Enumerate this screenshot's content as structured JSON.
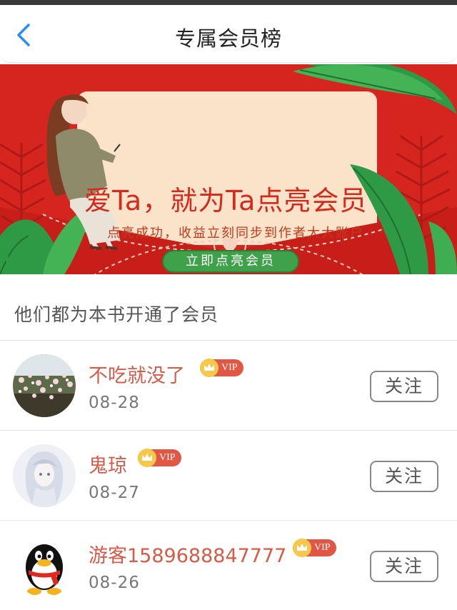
{
  "nav": {
    "title": "专属会员榜"
  },
  "banner": {
    "headline": "爱Ta，就为Ta点亮会员",
    "subtitle": "点亮成功，收益立刻同步到作者大大账户",
    "cta_label": "立即点亮会员"
  },
  "section": {
    "heading": "他们都为本书开通了会员"
  },
  "members": [
    {
      "name": "不吃就没了",
      "vip_label": "VIP",
      "date": "08-28",
      "follow_label": "关注",
      "avatar_icon": "flower-avatar-icon"
    },
    {
      "name": "鬼琼",
      "vip_label": "VIP",
      "date": "08-27",
      "follow_label": "关注",
      "avatar_icon": "anime-avatar-icon"
    },
    {
      "name": "游客1589688847777",
      "vip_label": "VIP",
      "date": "08-26",
      "follow_label": "关注",
      "avatar_icon": "qq-penguin-avatar-icon"
    }
  ],
  "colors": {
    "accent_blue": "#2a8ef0",
    "name_red": "#d85a48",
    "vip_red": "#e25744",
    "banner_red": "#d6251f",
    "cta_green": "#3fa14a"
  }
}
